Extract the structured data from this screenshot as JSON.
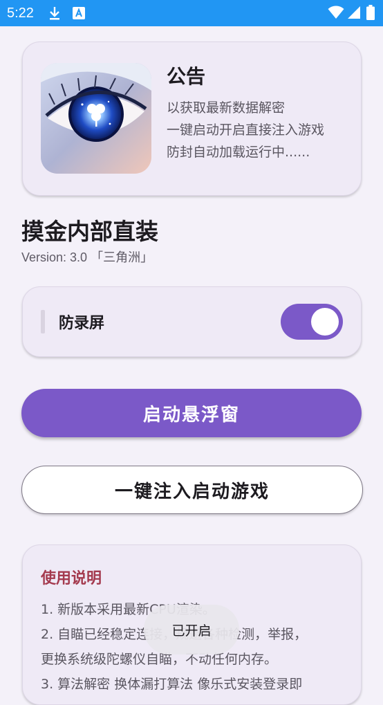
{
  "status_bar": {
    "time": "5:22",
    "left_icons": [
      "download-icon",
      "keyboard-a-icon"
    ],
    "right_icons": [
      "wifi-icon",
      "signal-icon",
      "battery-icon"
    ],
    "color": "#2196f3"
  },
  "notice": {
    "title": "公告",
    "lines": [
      "以获取最新数据解密",
      "一键启动开启直接注入游戏",
      "防封自动加载运行中......"
    ],
    "image": "eye-with-clover-art"
  },
  "app": {
    "title": "摸金内部直装",
    "version": "Version: 3.0 「三角洲」"
  },
  "screen_record_guard": {
    "label": "防录屏",
    "enabled": true
  },
  "buttons": {
    "floating_window": "启动悬浮窗",
    "inject_launch": "一键注入启动游戏"
  },
  "instructions": {
    "title": "使用说明",
    "lines": [
      "1. 新版本采用最新CPU渲染。",
      "2. 自瞄已经稳定连接，规避各种检测，举报，",
      "更换系统级陀螺仪自瞄，不动任何内存。",
      "3. 算法解密 换体漏打算法 像乐式安装登录即"
    ]
  },
  "toast": {
    "text": "已开启"
  },
  "colors": {
    "accent": "#7b59c8",
    "background": "#f4f1f9",
    "card": "#efeaf6",
    "instructions_title": "#a43a4e"
  }
}
